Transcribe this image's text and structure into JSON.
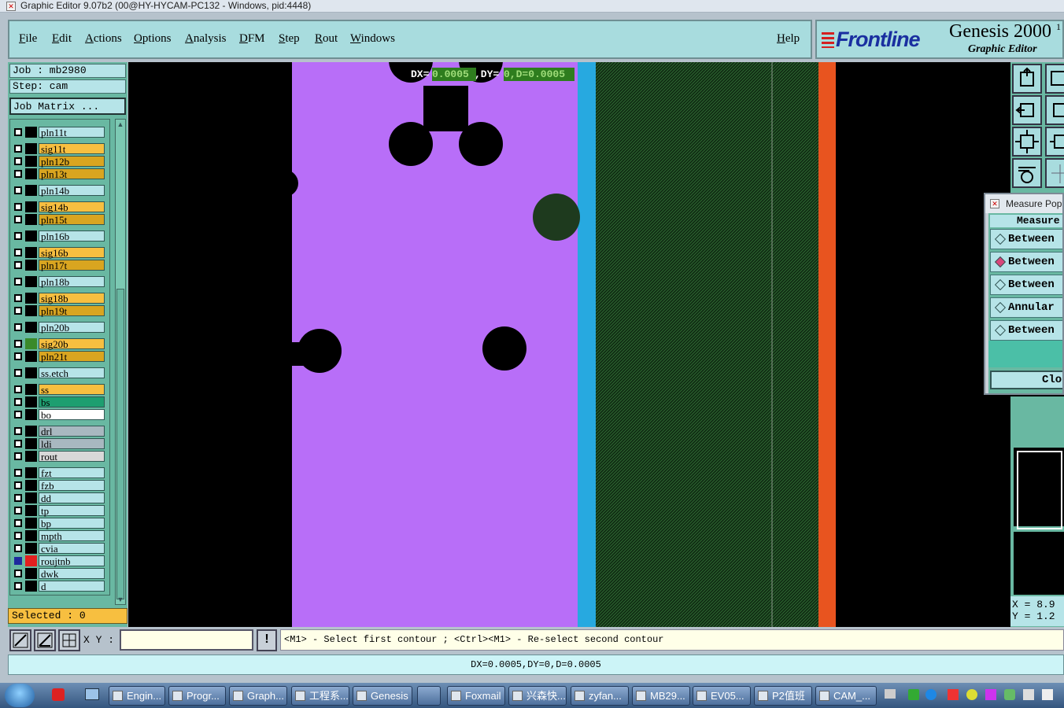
{
  "window": {
    "title": "Graphic Editor 9.07b2 (00@HY-HYCAM-PC132 - Windows, pid:4448)"
  },
  "menu": {
    "items": [
      "File",
      "Edit",
      "Actions",
      "Options",
      "Analysis",
      "DFM",
      "Step",
      "Rout",
      "Windows"
    ],
    "help": "Help"
  },
  "logo": {
    "brand": "Frontline",
    "product": "Genesis 2000",
    "superscript": "1",
    "subtitle": "Graphic Editor"
  },
  "job": {
    "job_label": "Job : mb2980",
    "step_label": "Step: cam",
    "matrix_button": "Job Matrix ..."
  },
  "layers": [
    {
      "name": "pln11t",
      "color": "#b6e4e8"
    },
    {
      "name": "sig11t",
      "color": "#f7bf40"
    },
    {
      "name": "pln12b",
      "color": "#d9a520"
    },
    {
      "name": "pln13t",
      "color": "#d9a520"
    },
    {
      "name": "pln14b",
      "color": "#b6e4e8"
    },
    {
      "name": "sig14b",
      "color": "#f7bf40"
    },
    {
      "name": "pln15t",
      "color": "#d9a520"
    },
    {
      "name": "pln16b",
      "color": "#b6e4e8"
    },
    {
      "name": "sig16b",
      "color": "#f7bf40"
    },
    {
      "name": "pln17t",
      "color": "#d9a520"
    },
    {
      "name": "pln18b",
      "color": "#b6e4e8"
    },
    {
      "name": "sig18b",
      "color": "#f7bf40"
    },
    {
      "name": "pln19t",
      "color": "#d9a520"
    },
    {
      "name": "pln20b",
      "color": "#b6e4e8"
    },
    {
      "name": "sig20b",
      "color": "#f7bf40"
    },
    {
      "name": "pln21t",
      "color": "#d9a520"
    },
    {
      "name": "ss.etch",
      "color": "#b6e4e8"
    },
    {
      "name": "ss",
      "color": "#f7bf40"
    },
    {
      "name": "bs",
      "color": "#1d9e70"
    },
    {
      "name": "bo",
      "color": "#ffffff"
    },
    {
      "name": "drl",
      "color": "#a8b8c0"
    },
    {
      "name": "ldi",
      "color": "#a8b8c0"
    },
    {
      "name": "rout",
      "color": "#d8d8d8"
    },
    {
      "name": "fzt",
      "color": "#b6e4e8"
    },
    {
      "name": "fzb",
      "color": "#b6e4e8"
    },
    {
      "name": "dd",
      "color": "#b6e4e8"
    },
    {
      "name": "tp",
      "color": "#b6e4e8"
    },
    {
      "name": "bp",
      "color": "#b6e4e8"
    },
    {
      "name": "mpth",
      "color": "#b6e4e8"
    },
    {
      "name": "cvia",
      "color": "#b6e4e8"
    },
    {
      "name": "roujtnb",
      "color": "#b6e4e8"
    },
    {
      "name": "dwk",
      "color": "#b6e4e8"
    },
    {
      "name": "d",
      "color": "#b6e4e8"
    }
  ],
  "selected": "Selected : 0",
  "canvas": {
    "overlay_prefix": "DX=",
    "overlay_dx": "0.0005",
    "overlay_mid": ",DY=",
    "overlay_rest": "0,D=0.0005",
    "colors": {
      "board": "#b86ef8",
      "cyan_strip": "#27a9e0",
      "orange_strip": "#e8541f",
      "hatched": "#1e3a1e"
    }
  },
  "measure": {
    "title": "Measure Pop",
    "header": "Measure",
    "options": [
      "Between",
      "Between",
      "Between",
      "Annular",
      "Between"
    ],
    "selected_index": 1,
    "close": "Clo"
  },
  "coords": {
    "x": "X = 8.9",
    "y": "Y = 1.2"
  },
  "command": {
    "xy_label": "X Y :",
    "xy_value": "",
    "prompt": "<M1> - Select first contour ; <Ctrl><M1> - Re-select second contour",
    "alert": "!"
  },
  "status": "DX=0.0005,DY=0,D=0.0005",
  "taskbar": {
    "items": [
      "Engin...",
      "Progr...",
      "Graph...",
      "工程系...",
      "Genesis",
      "Foxmail",
      "兴森快...",
      "zyfan...",
      "MB29...",
      "EV05...",
      "P2值班",
      "CAM_..."
    ]
  }
}
